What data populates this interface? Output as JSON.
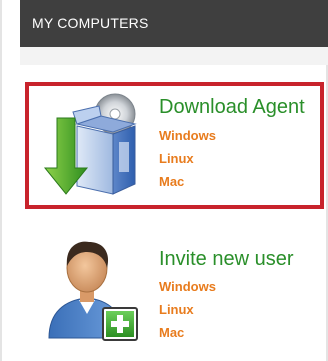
{
  "header": {
    "title": "MY COMPUTERS"
  },
  "items": [
    {
      "title": "Download Agent",
      "icon": "download-agent-icon",
      "links": [
        "Windows",
        "Linux",
        "Mac"
      ],
      "selected": true
    },
    {
      "title": "Invite new user",
      "icon": "invite-user-icon",
      "links": [
        "Windows",
        "Linux",
        "Mac"
      ],
      "selected": false
    }
  ],
  "colors": {
    "header_bg": "#3f3f3f",
    "title_green": "#2a8f2a",
    "link_orange": "#e87c1e",
    "selection_red": "#c8232c"
  }
}
